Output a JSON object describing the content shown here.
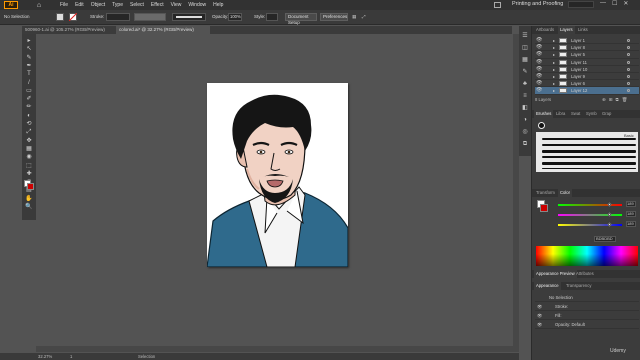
{
  "app": {
    "logo": "Ai",
    "home_icon": "home-icon",
    "workspace": "Printing and Proofing"
  },
  "menu": [
    "File",
    "Edit",
    "Object",
    "Type",
    "Select",
    "Effect",
    "View",
    "Window",
    "Help"
  ],
  "window_controls": [
    "—",
    "☐",
    "✕"
  ],
  "controlbar": {
    "selection": "No Selection",
    "stroke_label": "Stroke:",
    "opacity_label": "Opacity:",
    "opacity_value": "100%",
    "style_label": "Style:",
    "document_setup": "Document Setup",
    "preferences": "Preferences"
  },
  "tabs": [
    {
      "label": "500960-1.ai @ 105.27% (RGB/Preview)",
      "active": false
    },
    {
      "label": "colored.ai* @ 32.27% (RGB/Preview)",
      "active": true
    }
  ],
  "tools": [
    "▸",
    "↖",
    "✎",
    "✒",
    "T",
    "/",
    "▭",
    "✐",
    "✏",
    "◐",
    "⟲",
    "⤢",
    "✥",
    "▦",
    "◉",
    "⬚",
    "✚",
    "≡",
    "▤",
    "✋",
    "🔍"
  ],
  "panels": {
    "layers_tabs": [
      "Artboards",
      "Layers",
      "Links"
    ],
    "layers": [
      {
        "name": "Layer 1",
        "selected": false
      },
      {
        "name": "Layer 8",
        "selected": false
      },
      {
        "name": "Layer 5",
        "selected": false
      },
      {
        "name": "Layer 11",
        "selected": false
      },
      {
        "name": "Layer 10",
        "selected": false
      },
      {
        "name": "Layer 9",
        "selected": false
      },
      {
        "name": "Layer 6",
        "selected": false
      },
      {
        "name": "Layer 12",
        "selected": true
      }
    ],
    "layers_count": "8 Layers",
    "brushes_tabs": [
      "Brushes",
      "Libra",
      "Swat",
      "Symb",
      "Grap"
    ],
    "brush_label": "Basic",
    "color_tabs": [
      "Transform",
      "Color"
    ],
    "color_values": [
      "189",
      "189",
      "189"
    ],
    "color_hex": "BDBDBD",
    "appearance_top_tabs": [
      "Appearance Preview",
      "Attributes"
    ],
    "appearance_tabs": [
      "Appearance",
      "Transparency"
    ],
    "appearance_rows": [
      {
        "label": "No Selection"
      },
      {
        "label": "Stroke:"
      },
      {
        "label": "Fill:"
      },
      {
        "label": "Opacity: Default"
      }
    ]
  },
  "status": {
    "zoom": "32.27%",
    "page": "1",
    "mode": "Selection"
  },
  "watermark": "Udemy",
  "colors": {
    "accent": "#4b6f8f",
    "brand": "#ff9a00",
    "jacket": "#2f6a8c",
    "hair": "#151515",
    "skin": "#f1d2c4"
  }
}
